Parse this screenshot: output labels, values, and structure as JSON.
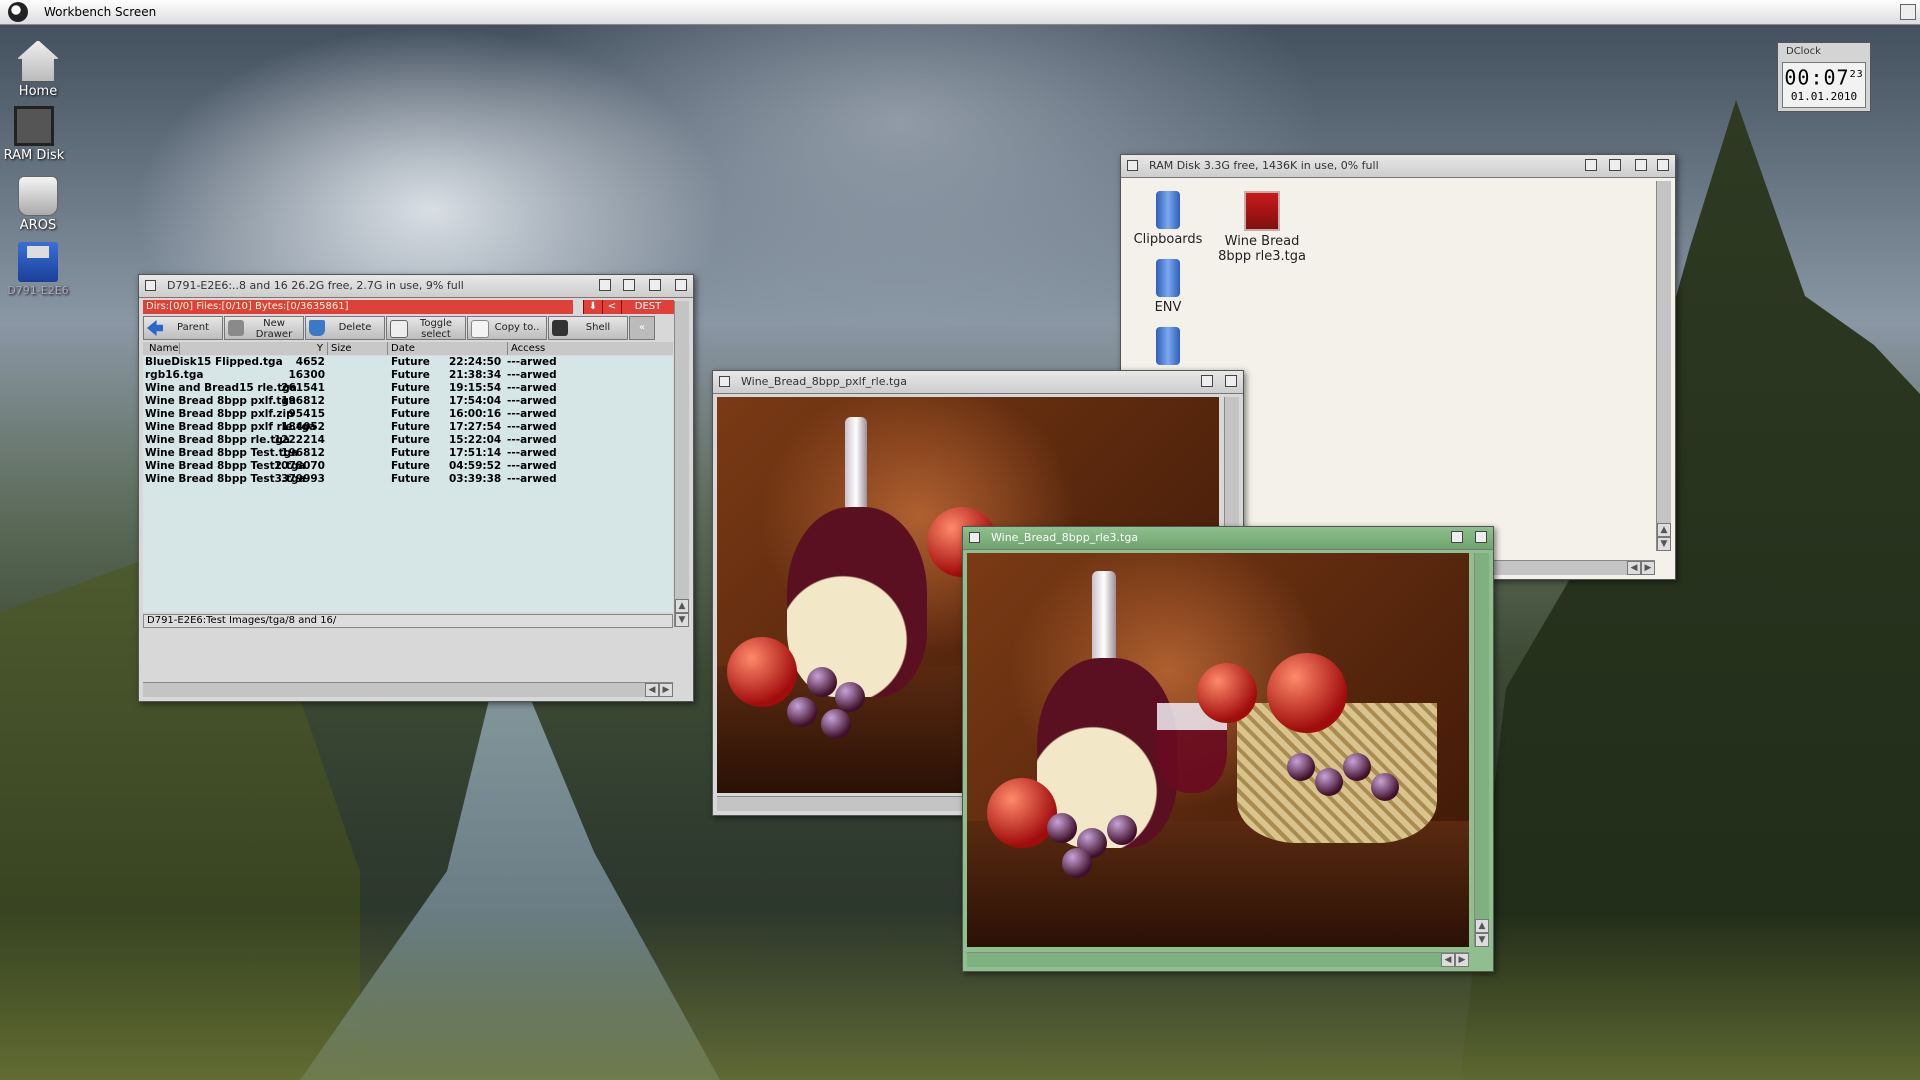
{
  "screen": {
    "title": "Workbench Screen"
  },
  "desktop_icons": [
    {
      "label": "Home"
    },
    {
      "label": "RAM Disk"
    },
    {
      "label": "AROS"
    },
    {
      "label": "D791-E2E6"
    }
  ],
  "dclock": {
    "title": "DClock",
    "time": "00:07",
    "seconds": "23",
    "date": "01.01.2010"
  },
  "lister": {
    "title": "D791-E2E6:..8 and 16  26.2G free, 2.7G in use, 9% full",
    "status": "Dirs:[0/0] Files:[0/10] Bytes:[0/3635861]",
    "status_buttons": {
      "sort_arrow": "⬇",
      "back": "<",
      "dest": "DEST"
    },
    "toolbar": {
      "parent": "Parent",
      "new_drawer_1": "New",
      "new_drawer_2": "Drawer",
      "delete": "Delete",
      "toggle_1": "Toggle",
      "toggle_2": "select",
      "copy": "Copy to..",
      "shell": "Shell"
    },
    "columns": {
      "name": "Name",
      "sort_flag": "Y",
      "size": "Size",
      "date": "Date",
      "access": "Access"
    },
    "files": [
      {
        "name": "BlueDisk15 Flipped.tga",
        "size": "4652",
        "date": "Future",
        "time": "22:24:50",
        "access": "---arwed"
      },
      {
        "name": "rgb16.tga",
        "size": "16300",
        "date": "Future",
        "time": "21:38:34",
        "access": "---arwed"
      },
      {
        "name": "Wine and Bread15 rle.tga",
        "size": "261541",
        "date": "Future",
        "time": "19:15:54",
        "access": "---arwed"
      },
      {
        "name": "Wine Bread 8bpp pxlf.tga",
        "size": "196812",
        "date": "Future",
        "time": "17:54:04",
        "access": "---arwed"
      },
      {
        "name": "Wine Bread 8bpp pxlf.zip",
        "size": "95415",
        "date": "Future",
        "time": "16:00:16",
        "access": "---arwed"
      },
      {
        "name": "Wine Bread 8bpp pxlf rle.tga",
        "size": "184052",
        "date": "Future",
        "time": "17:27:54",
        "access": "---arwed"
      },
      {
        "name": "Wine Bread 8bpp rle.tga",
        "size": "1222214",
        "date": "Future",
        "time": "15:22:04",
        "access": "---arwed"
      },
      {
        "name": "Wine Bread 8bpp Test.tga",
        "size": "196812",
        "date": "Future",
        "time": "17:51:14",
        "access": "---arwed"
      },
      {
        "name": "Wine Bread 8bpp Test2.tga",
        "size": "1078070",
        "date": "Future",
        "time": "04:59:52",
        "access": "---arwed"
      },
      {
        "name": "Wine Bread 8bpp Test3.tga",
        "size": "379993",
        "date": "Future",
        "time": "03:39:38",
        "access": "---arwed"
      }
    ],
    "path": "D791-E2E6:Test Images/tga/8 and 16/"
  },
  "ramdisk": {
    "title": "RAM Disk  3.3G free, 1436K in use, 0% full",
    "items": [
      {
        "label": "Clipboards",
        "type": "drawer"
      },
      {
        "label": "Wine  Bread",
        "label2": "8bpp  rle3.tga",
        "type": "picture"
      },
      {
        "label": "ENV",
        "type": "drawer"
      },
      {
        "label": "",
        "type": "drawer"
      }
    ]
  },
  "viewer1": {
    "title": "Wine_Bread_8bpp_pxlf_rle.tga"
  },
  "viewer2": {
    "title": "Wine_Bread_8bpp_rle3.tga"
  },
  "colors": {
    "lister_status": "#e0403a",
    "file_bg": "#d6e6e6",
    "active_window": "#8fbf8f"
  }
}
